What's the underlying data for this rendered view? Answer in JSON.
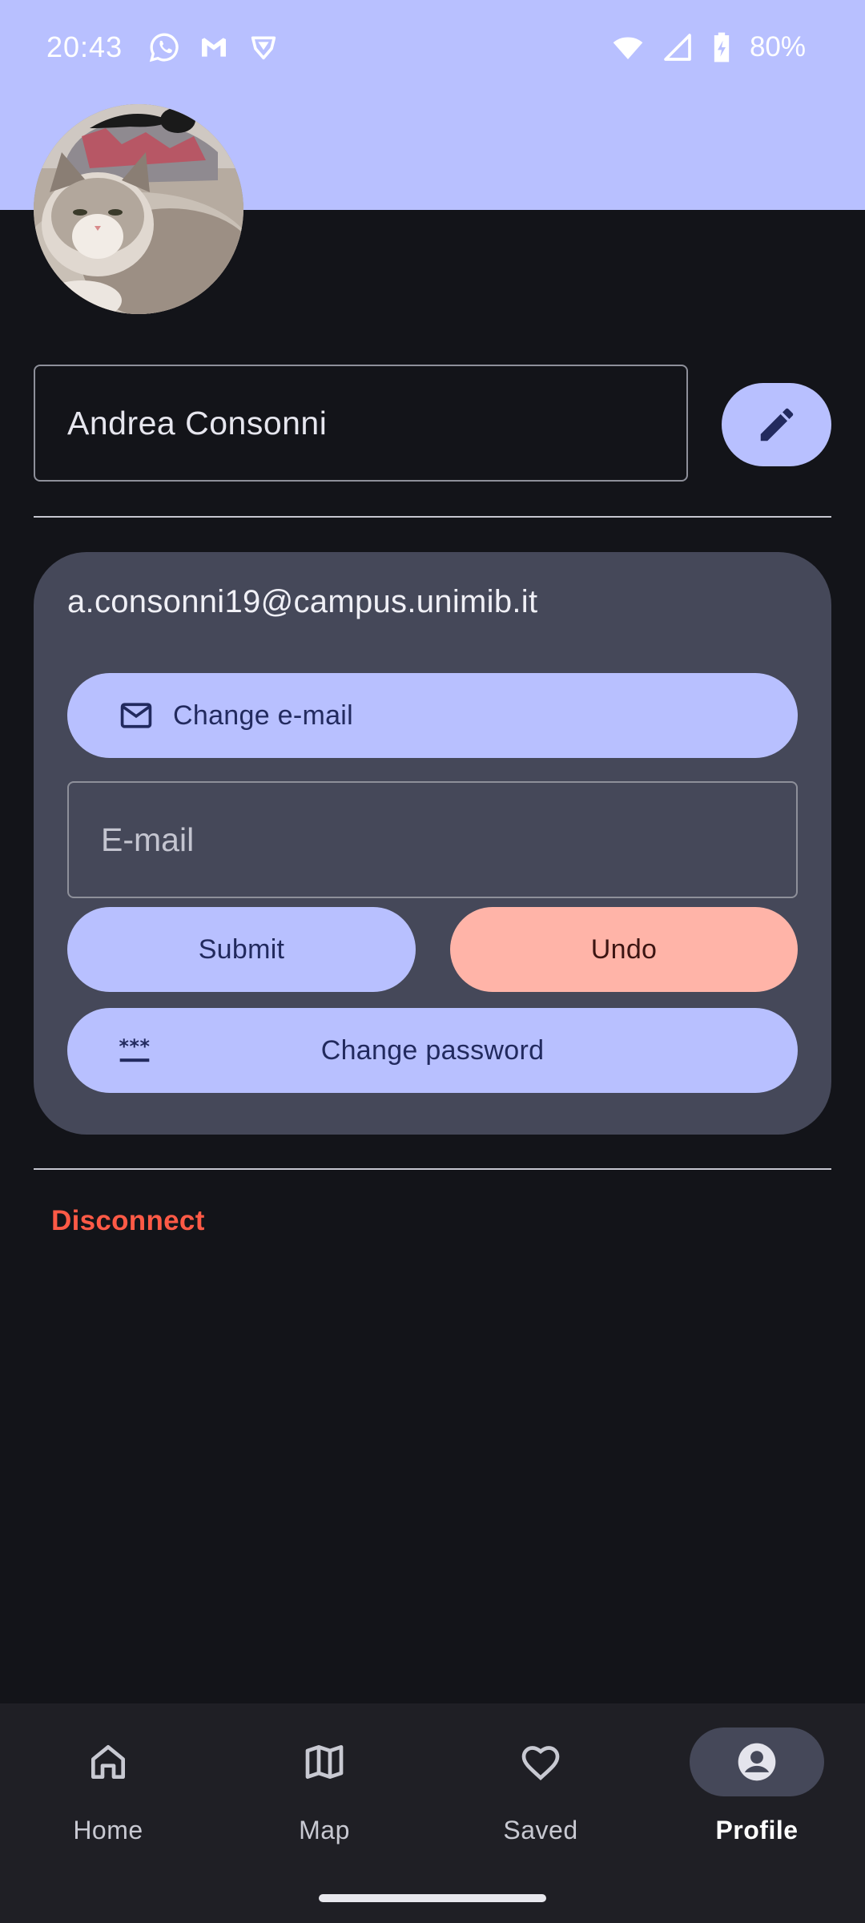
{
  "status_bar": {
    "time": "20:43",
    "battery": "80%",
    "left_icons": [
      "whatsapp-icon",
      "gmail-icon",
      "vpn-icon"
    ],
    "right_icons": [
      "wifi-icon",
      "signal-icon",
      "battery-charging-icon"
    ]
  },
  "profile": {
    "name": "Andrea Consonni",
    "email": "a.consonni19@campus.unimib.it"
  },
  "email_card": {
    "change_email_label": "Change e-mail",
    "email_placeholder": "E-mail",
    "submit_label": "Submit",
    "undo_label": "Undo",
    "change_password_label": "Change password"
  },
  "disconnect_label": "Disconnect",
  "nav": {
    "items": [
      {
        "label": "Home",
        "icon": "home-icon"
      },
      {
        "label": "Map",
        "icon": "map-icon"
      },
      {
        "label": "Saved",
        "icon": "heart-icon"
      },
      {
        "label": "Profile",
        "icon": "account-circle-icon",
        "active": true
      }
    ]
  },
  "colors": {
    "accent": "#b8c0ff",
    "background": "#131419",
    "card": "#454859",
    "danger": "#ff5a46",
    "undo": "#ffb4a8"
  }
}
